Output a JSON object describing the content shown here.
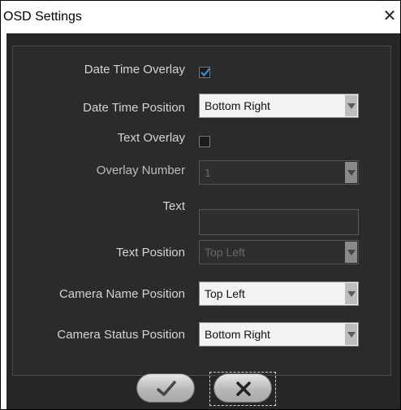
{
  "window": {
    "title": "OSD Settings",
    "close_glyph": "✕"
  },
  "fields": {
    "date_time_overlay": {
      "label": "Date Time Overlay",
      "checked": true
    },
    "date_time_position": {
      "label": "Date Time Position",
      "value": "Bottom Right"
    },
    "text_overlay": {
      "label": "Text Overlay",
      "checked": false
    },
    "overlay_number": {
      "label": "Overlay Number",
      "value": "1",
      "enabled": false
    },
    "text": {
      "label": "Text",
      "value": "",
      "enabled": false
    },
    "text_position": {
      "label": "Text Position",
      "value": "Top Left",
      "enabled": false
    },
    "camera_name_position": {
      "label": "Camera Name Position",
      "value": "Top Left"
    },
    "camera_status_position": {
      "label": "Camera Status Position",
      "value": "Bottom Right"
    }
  },
  "buttons": {
    "ok_icon": "checkmark-icon",
    "cancel_icon": "x-icon"
  },
  "colors": {
    "checkbox_check": "#3a8fd9",
    "dialog_bg": "#262626",
    "panel_bg": "#2b2b2b"
  }
}
